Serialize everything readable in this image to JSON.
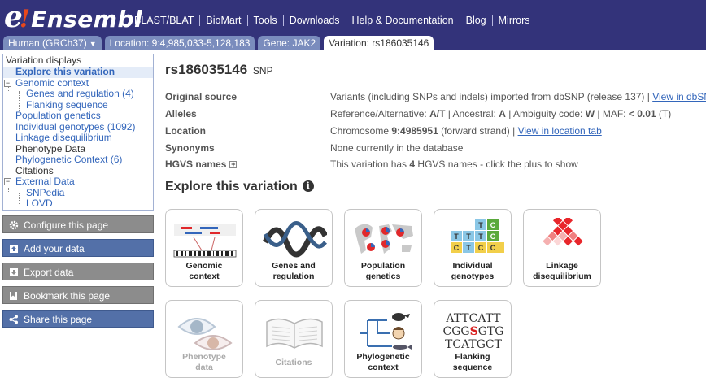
{
  "logo": {
    "e": "e",
    "bang": "!",
    "name": "Ensembl"
  },
  "topnav": [
    "BLAST/BLAT",
    "BioMart",
    "Tools",
    "Downloads",
    "Help & Documentation",
    "Blog",
    "Mirrors"
  ],
  "tabs": [
    {
      "label": "Human (GRCh37)",
      "caret": "▼"
    },
    {
      "label": "Location: 9:4,985,033-5,128,183"
    },
    {
      "label": "Gene: JAK2"
    },
    {
      "label": "Variation: rs186035146"
    }
  ],
  "sidebar": {
    "title": "Variation displays",
    "items": [
      "Explore this variation",
      "Genomic context",
      "Genes and regulation (4)",
      "Flanking sequence",
      "Population genetics",
      "Individual genotypes (1092)",
      "Linkage disequilibrium",
      "Phenotype Data",
      "Phylogenetic Context (6)",
      "Citations",
      "External Data",
      "SNPedia",
      "LOVD"
    ]
  },
  "tools": [
    "Configure this page",
    "Add your data",
    "Export data",
    "Bookmark this page",
    "Share this page"
  ],
  "page": {
    "title": "rs186035146",
    "type": "SNP",
    "explore_heading": "Explore this variation"
  },
  "fields": {
    "source_key": "Original source",
    "source_val": "Variants (including SNPs and indels) imported from dbSNP (release 137) | ",
    "source_link": "View in dbSNP",
    "alleles_key": "Alleles",
    "alleles_ref_label": "Reference/Alternative: ",
    "alleles_ref": "A/T",
    "alleles_anc_label": " | Ancestral: ",
    "alleles_anc": "A",
    "alleles_amb_label": " | Ambiguity code: ",
    "alleles_amb": "W",
    "alleles_maf_label": " | MAF: ",
    "alleles_maf": "< 0.01",
    "alleles_maf_allele": " (T)",
    "location_key": "Location",
    "location_pre": "Chromosome ",
    "location_pos": "9:4985951",
    "location_post": " (forward strand) | ",
    "location_link": "View in location tab",
    "synonyms_key": "Synonyms",
    "synonyms_val": "None currently in the database",
    "hgvs_key": "HGVS names",
    "hgvs_plus": "+",
    "hgvs_pre": "This variation has ",
    "hgvs_count": "4",
    "hgvs_post": " HGVS names - click the plus to show"
  },
  "cards": [
    {
      "label1": "Genomic",
      "label2": "context"
    },
    {
      "label1": "Genes and",
      "label2": "regulation"
    },
    {
      "label1": "Population",
      "label2": "genetics"
    },
    {
      "label1": "Individual",
      "label2": "genotypes"
    },
    {
      "label1": "Linkage",
      "label2": "disequilibrium"
    },
    {
      "label1": "Phenotype",
      "label2": "data"
    },
    {
      "label1": "Citations",
      "label2": ""
    },
    {
      "label1": "Phylogenetic",
      "label2": "context"
    },
    {
      "label1": "Flanking",
      "label2": "sequence"
    }
  ],
  "genotype_letters": [
    "T",
    "C",
    "T",
    "T",
    "T",
    "C",
    "C",
    "T",
    "C",
    "C",
    "C"
  ],
  "flanking_lines": [
    "ATTCATT",
    "CGGSGTG",
    "TCATGCT"
  ],
  "colors": {
    "masthead": "#33337a",
    "tab": "#7a8cbd",
    "link": "#3366bb",
    "tool_grey": "#8c8c8c",
    "tool_blue": "#5370a8",
    "ld_red": "#e8262b",
    "flank_highlight": "#d81d1d"
  }
}
